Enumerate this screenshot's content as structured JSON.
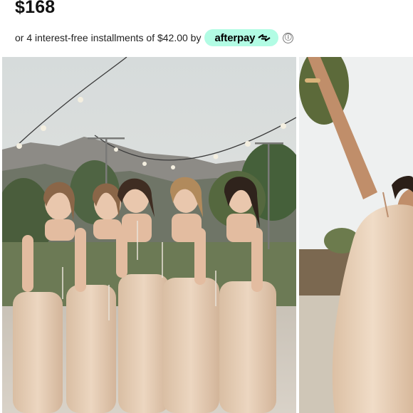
{
  "product": {
    "price": "$168",
    "installments_text": "or 4 interest-free installments of $42.00 by",
    "afterpay_label": "afterpay",
    "info_icon": "ⓘ"
  },
  "icons": {
    "afterpay_logo": "afterpay-arrows-icon",
    "info": "info-circle-icon"
  },
  "colors": {
    "afterpay_mint": "#b2fce4",
    "dress_champagne": "#e6cdb3",
    "sky": "#dfe3e2"
  },
  "gallery": {
    "images": [
      {
        "name": "main-photo",
        "alt": "Bridesmaids in champagne satin slip dresses holding champagne glasses outdoors"
      },
      {
        "name": "next-photo",
        "alt": "Woman in champagne slip dress raising arm"
      }
    ]
  }
}
